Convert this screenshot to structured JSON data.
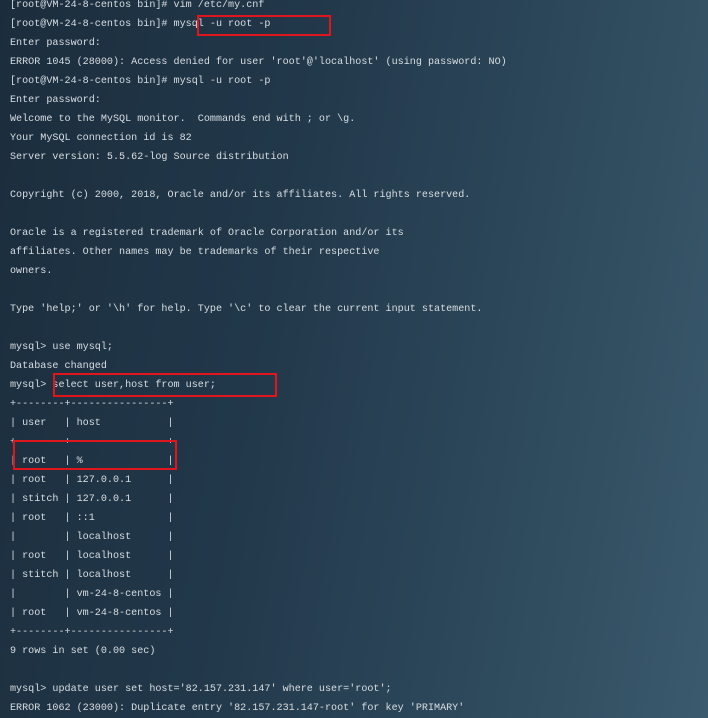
{
  "terminal": {
    "lines": [
      "[root@VM-24-8-centos bin]# vim /etc/my.cnf",
      "[root@VM-24-8-centos bin]# mysql -u root -p",
      "Enter password:",
      "ERROR 1045 (28000): Access denied for user 'root'@'localhost' (using password: NO)",
      "[root@VM-24-8-centos bin]# mysql -u root -p",
      "Enter password:",
      "Welcome to the MySQL monitor.  Commands end with ; or \\g.",
      "Your MySQL connection id is 82",
      "Server version: 5.5.62-log Source distribution",
      "",
      "Copyright (c) 2000, 2018, Oracle and/or its affiliates. All rights reserved.",
      "",
      "Oracle is a registered trademark of Oracle Corporation and/or its",
      "affiliates. Other names may be trademarks of their respective",
      "owners.",
      "",
      "Type 'help;' or '\\h' for help. Type '\\c' to clear the current input statement.",
      "",
      "mysql> use mysql;",
      "Database changed",
      "mysql> select user,host from user;",
      "+--------+----------------+",
      "| user   | host           |",
      "+--------+----------------+",
      "| root   | %              |",
      "| root   | 127.0.0.1      |",
      "| stitch | 127.0.0.1      |",
      "| root   | ::1            |",
      "|        | localhost      |",
      "| root   | localhost      |",
      "| stitch | localhost      |",
      "|        | vm-24-8-centos |",
      "| root   | vm-24-8-centos |",
      "+--------+----------------+",
      "9 rows in set (0.00 sec)",
      "",
      "mysql> update user set host='82.157.231.147' where user='root';",
      "ERROR 1062 (23000): Duplicate entry '82.157.231.147-root' for key 'PRIMARY'"
    ]
  },
  "colors": {
    "highlight": "#e0161c",
    "text": "#d9dee2",
    "background": "#22394b"
  }
}
